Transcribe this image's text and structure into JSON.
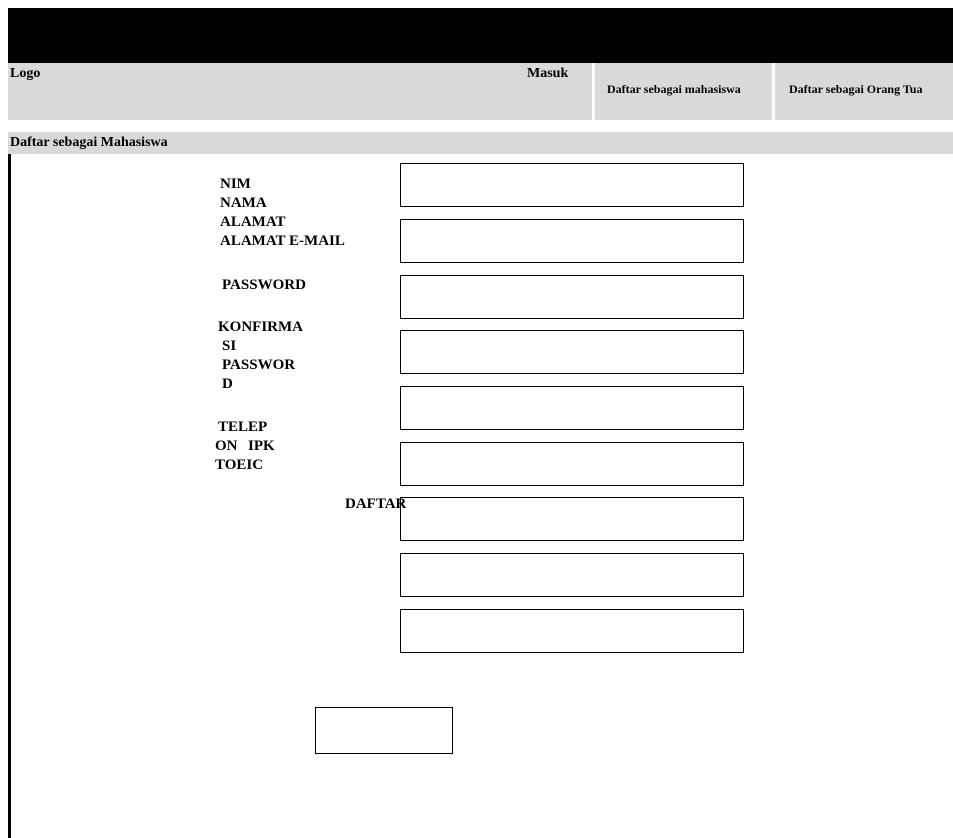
{
  "header": {
    "logo": "Logo",
    "nav": {
      "login": "Masuk",
      "register_student": "Daftar sebagai mahasiswa",
      "register_parent": "Daftar sebagai Orang Tua"
    }
  },
  "page": {
    "title": "Daftar sebagai Mahasiswa"
  },
  "form": {
    "labels": {
      "nim": "NIM",
      "nama": "NAMA",
      "alamat": "ALAMAT",
      "email": "ALAMAT E-MAIL",
      "password": "PASSWORD",
      "confirm_1": "KONFIRMA",
      "confirm_2": "SI",
      "confirm_3": "PASSWOR",
      "confirm_4": "D",
      "telepon_1": "TELEP",
      "telepon_2": "ON",
      "ipk": "IPK",
      "toeic": "TOEIC"
    },
    "values": {
      "nim": "",
      "nama": "",
      "alamat": "",
      "email": "",
      "password": "",
      "confirm_password": "",
      "telepon": "",
      "ipk": "",
      "toeic": ""
    },
    "submit_label": "DAFTAR"
  }
}
